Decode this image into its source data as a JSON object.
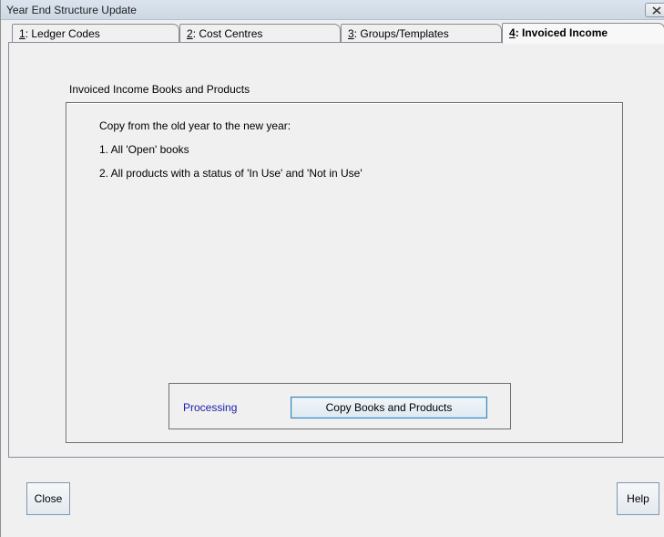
{
  "window": {
    "title": "Year End Structure Update"
  },
  "tabs": [
    {
      "key": "1",
      "rest": ": Ledger Codes",
      "active": false
    },
    {
      "key": "2",
      "rest": ": Cost Centres",
      "active": false
    },
    {
      "key": "3",
      "rest": ": Groups/Templates",
      "active": false
    },
    {
      "key": "4",
      "rest": ": Invoiced Income",
      "active": true
    }
  ],
  "page": {
    "section_label": "Invoiced Income Books and Products",
    "lines": [
      "Copy from the old year to the new year:",
      "1. All 'Open' books",
      "2. All products with a status of 'In Use' and 'Not in Use'"
    ],
    "processing_label": "Processing",
    "copy_button": "Copy Books and Products",
    "status_color": "#1b1bb5"
  },
  "footer": {
    "close_label": "Close",
    "help_label": "Help"
  }
}
